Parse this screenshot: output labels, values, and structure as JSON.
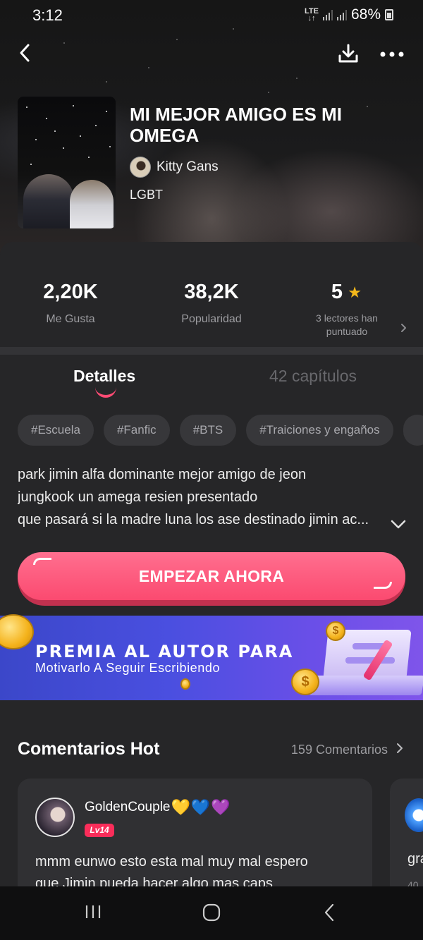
{
  "status_bar": {
    "time": "3:12",
    "network": "LTE",
    "battery": "68%"
  },
  "header": {
    "back_icon": "back-arrow-icon",
    "download_icon": "download-icon",
    "more_icon": "more-dots-icon"
  },
  "book": {
    "title": "MI MEJOR AMIGO ES MI OMEGA",
    "author": "Kitty Gans",
    "genre": "LGBT"
  },
  "stats": {
    "likes": {
      "value": "2,20K",
      "label": "Me Gusta"
    },
    "popularity": {
      "value": "38,2K",
      "label": "Popularidad"
    },
    "rating": {
      "value": "5",
      "label_line1": "3 lectores han",
      "label_line2": "puntuado"
    }
  },
  "tabs": {
    "details": "Detalles",
    "chapters": "42 capítulos"
  },
  "tags": [
    "#Escuela",
    "#Fanfic",
    "#BTS",
    "#Traiciones y engaños"
  ],
  "description": {
    "line1": "park jimin alfa dominante mejor amigo de jeon",
    "line2": "jungkook un amega resien presentado",
    "line3": "que pasará si la madre luna los ase destinado jimin ac..."
  },
  "cta": {
    "label": "EMPEZAR AHORA"
  },
  "banner": {
    "title": "PREMIA AL AUTOR PARA",
    "subtitle": "Motivarlo A Seguir Escribiendo",
    "coin_symbol": "$"
  },
  "comments": {
    "section_title": "Comentarios Hot",
    "count_label": "159 Comentarios",
    "items": [
      {
        "username": "GoldenCouple",
        "hearts": [
          "💛",
          "💙",
          "💜"
        ],
        "level": "Lv14",
        "text_line1": "mmm eunwo esto esta mal muy mal espero",
        "text_line2": "que Jimin pueda hacer algo mas caps"
      },
      {
        "text": "gra",
        "sub": "40"
      }
    ]
  },
  "colors": {
    "accent": "#fb4a70",
    "star": "#f5b91b",
    "background": "#262628",
    "banner_blue": "#4a4fe0"
  }
}
